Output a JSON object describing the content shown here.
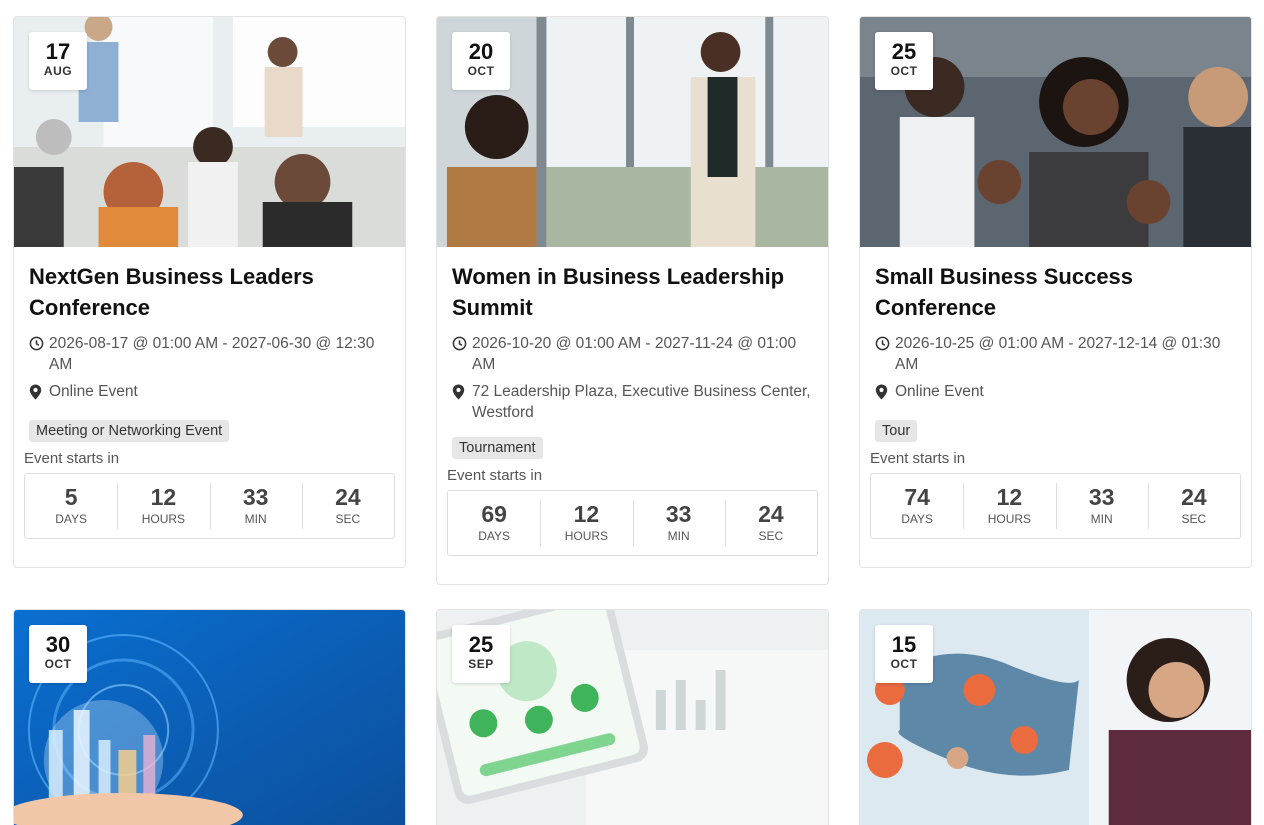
{
  "events": [
    {
      "day": "17",
      "month": "AUG",
      "title": "NextGen Business Leaders Conference",
      "datetime": "2026-08-17 @ 01:00 AM - 2027-06-30 @ 12:30 AM",
      "location": "Online Event",
      "tag": "Meeting or Networking Event",
      "starts_label": "Event starts in",
      "countdown": {
        "days": "5",
        "hours": "12",
        "min": "33",
        "sec": "24"
      },
      "labels": {
        "days": "DAYS",
        "hours": "HOURS",
        "min": "MIN",
        "sec": "SEC"
      }
    },
    {
      "day": "20",
      "month": "OCT",
      "title": "Women in Business Leadership Summit",
      "datetime": "2026-10-20 @ 01:00 AM - 2027-11-24 @ 01:00 AM",
      "location": "72 Leadership Plaza, Executive Business Center, Westford",
      "tag": "Tournament",
      "starts_label": "Event starts in",
      "countdown": {
        "days": "69",
        "hours": "12",
        "min": "33",
        "sec": "24"
      },
      "labels": {
        "days": "DAYS",
        "hours": "HOURS",
        "min": "MIN",
        "sec": "SEC"
      }
    },
    {
      "day": "25",
      "month": "OCT",
      "title": "Small Business Success Conference",
      "datetime": "2026-10-25 @ 01:00 AM - 2027-12-14 @ 01:30 AM",
      "location": "Online Event",
      "tag": "Tour",
      "starts_label": "Event starts in",
      "countdown": {
        "days": "74",
        "hours": "12",
        "min": "33",
        "sec": "24"
      },
      "labels": {
        "days": "DAYS",
        "hours": "HOURS",
        "min": "MIN",
        "sec": "SEC"
      }
    },
    {
      "day": "30",
      "month": "OCT"
    },
    {
      "day": "25",
      "month": "SEP"
    },
    {
      "day": "15",
      "month": "OCT"
    }
  ],
  "icons": {
    "time": "clock-icon",
    "location": "map-pin-icon"
  },
  "colors": {
    "card_border": "#e3e3e3",
    "tag_bg": "#e6e6e6",
    "title": "#111111"
  }
}
